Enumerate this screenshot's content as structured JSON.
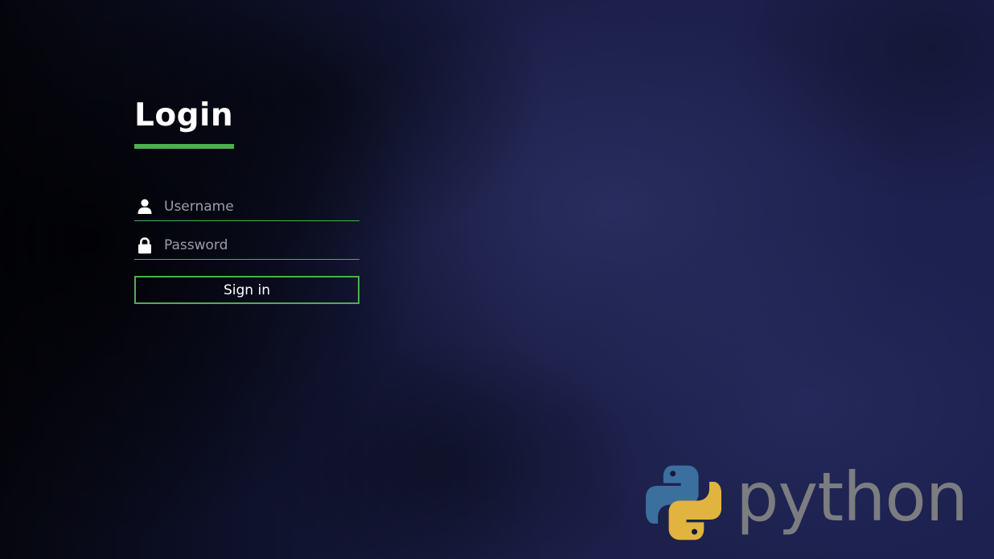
{
  "page": {
    "title": "Login"
  },
  "form": {
    "username": {
      "placeholder": "Username",
      "value": "",
      "icon": "user-icon"
    },
    "password": {
      "placeholder": "Password",
      "value": "",
      "icon": "lock-icon"
    },
    "submit_label": "Sign in"
  },
  "branding": {
    "wordmark": "python",
    "logo_colors": {
      "blue": "#3b6f9e",
      "yellow": "#e0b43e",
      "wordmark": "#7c7d80"
    }
  },
  "colors": {
    "accent": "#4caf50",
    "text": "#ffffff",
    "placeholder": "#9a9ca8",
    "background": "#161a3a"
  }
}
